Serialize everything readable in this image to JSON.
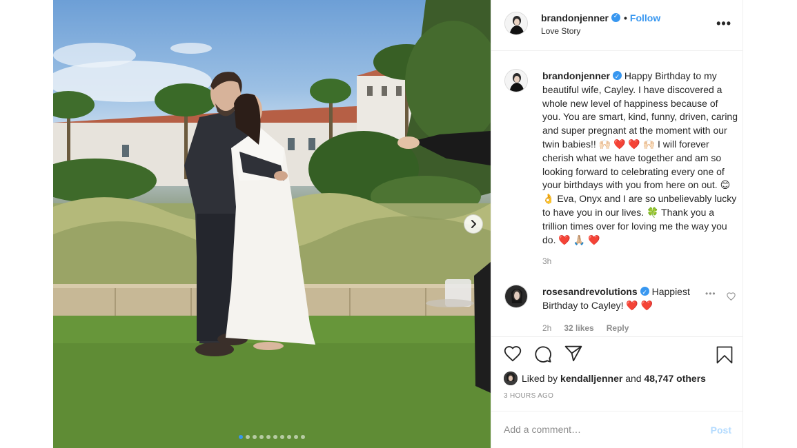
{
  "header": {
    "username": "brandonjenner",
    "separator": "•",
    "follow_label": "Follow",
    "subtitle": "Love Story",
    "more_icon": "more-horizontal-icon"
  },
  "caption": {
    "username": "brandonjenner",
    "text": "Happy Birthday to my beautiful wife, Cayley. I have discovered a whole new level of happiness because of you. You are smart, kind, funny, driven, caring and super pregnant at the moment with our twin babies!! 🙌🏻 ❤️ ❤️ 🙌🏻  I will forever cherish what we have together and am so looking forward to celebrating every one of your birthdays with you from here on out. 😊 👌  Eva, Onyx and I are so unbelievably lucky to have you in our lives. 🍀  Thank you a trillion times over for loving me the way you do. ❤️ 🙏🏼 ❤️",
    "time": "3h"
  },
  "comment": {
    "username": "rosesandrevolutions",
    "text": "Happiest Birthday to Cayley! ❤️ ❤️",
    "time": "2h",
    "likes": "32 likes",
    "reply_label": "Reply"
  },
  "likes": {
    "prefix": "Liked by",
    "user": "kendalljenner",
    "and": "and",
    "others": "48,747 others"
  },
  "posted": "3 HOURS AGO",
  "add_comment": {
    "placeholder": "Add a comment…",
    "post_label": "Post"
  },
  "carousel": {
    "slide_count": 10,
    "active_index": 0
  },
  "colors": {
    "accent": "#3897f0",
    "post_disabled": "#b3dbff",
    "heart_red": "#ed4956",
    "secondary_text": "#8e8e8e",
    "border": "#efefef"
  }
}
